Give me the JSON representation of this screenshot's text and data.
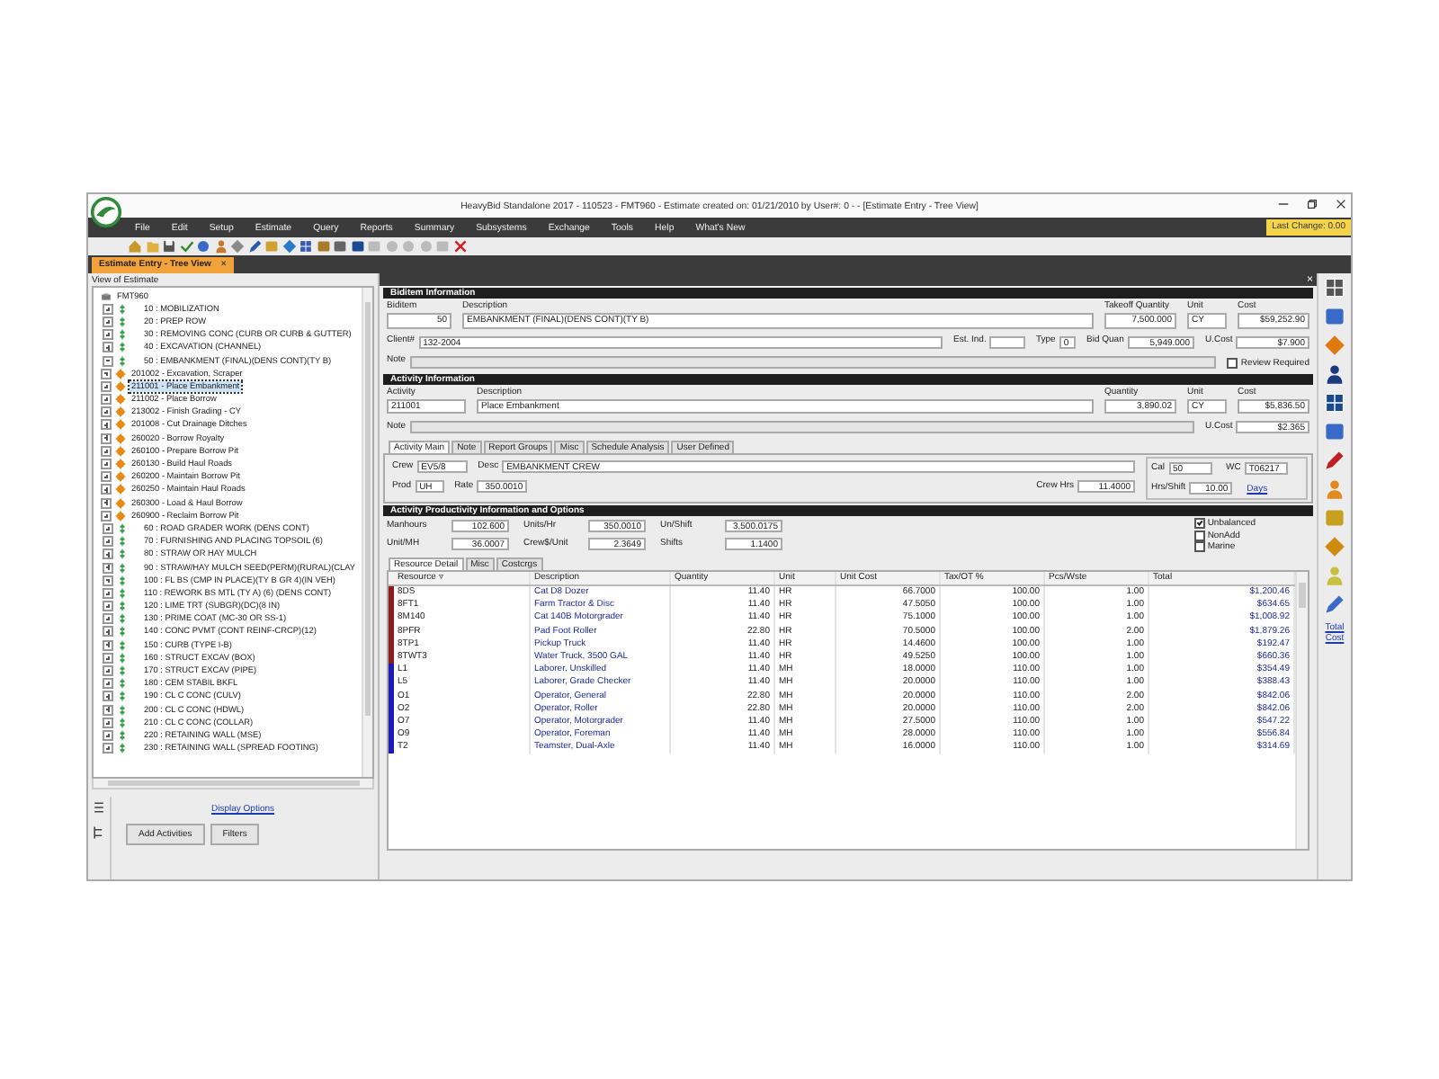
{
  "window": {
    "title": "HeavyBid Standalone 2017 - 110523 - FMT960 - Estimate created on: 01/21/2010 by User#: 0 - - [Estimate Entry - Tree View]"
  },
  "menu": [
    "File",
    "Edit",
    "Setup",
    "Estimate",
    "Query",
    "Reports",
    "Summary",
    "Subsystems",
    "Exchange",
    "Tools",
    "Help",
    "What's New"
  ],
  "last_change": "Last Change: 0.00",
  "document_tab": {
    "label": "Estimate Entry - Tree View",
    "close": "×"
  },
  "panel_close": "×",
  "tree": {
    "caption": "View of Estimate",
    "root": "FMT960",
    "items": [
      {
        "label": "10 : MOBILIZATION",
        "expanded": false
      },
      {
        "label": "20 : PREP ROW",
        "expanded": false
      },
      {
        "label": "30 : REMOVING CONC (CURB OR CURB & GUTTER)",
        "expanded": false
      },
      {
        "label": "40 : EXCAVATION (CHANNEL)",
        "expanded": false
      },
      {
        "label": "50 : EMBANKMENT (FINAL)(DENS CONT)(TY B)",
        "expanded": true,
        "children": [
          {
            "label": "201002 - Excavation, Scraper",
            "selected": false
          },
          {
            "label": "211001 - Place Embankment",
            "selected": true
          },
          {
            "label": "211002 - Place Borrow",
            "selected": false
          },
          {
            "label": "213002 - Finish Grading - CY",
            "selected": false
          },
          {
            "label": "201008 - Cut Drainage Ditches",
            "selected": false
          },
          {
            "label": "260020 - Borrow Royalty",
            "selected": false
          },
          {
            "label": "260100 - Prepare Borrow Pit",
            "selected": false
          },
          {
            "label": "260130 - Build Haul Roads",
            "selected": false
          },
          {
            "label": "260200 - Maintain Borrow Pit",
            "selected": false
          },
          {
            "label": "260250 - Maintain Haul Roads",
            "selected": false
          },
          {
            "label": "260300 - Load & Haul Borrow",
            "selected": false
          },
          {
            "label": "260900 - Reclaim Borrow Pit",
            "selected": false
          }
        ]
      },
      {
        "label": "60 : ROAD GRADER WORK (DENS CONT)",
        "expanded": false
      },
      {
        "label": "70 : FURNISHING AND PLACING TOPSOIL (6)",
        "expanded": false
      },
      {
        "label": "80 : STRAW OR HAY MULCH",
        "expanded": false
      },
      {
        "label": "90 : STRAW/HAY MULCH SEED(PERM)(RURAL)(CLAY",
        "expanded": false
      },
      {
        "label": "100 : FL BS (CMP IN PLACE)(TY B GR 4)(IN VEH)",
        "expanded": false
      },
      {
        "label": "110 : REWORK BS MTL (TY A) (6) (DENS CONT)",
        "expanded": false
      },
      {
        "label": "120 : LIME TRT (SUBGR)(DC)(8 IN)",
        "expanded": false
      },
      {
        "label": "130 : PRIME COAT (MC-30 OR SS-1)",
        "expanded": false
      },
      {
        "label": "140 : CONC PVMT (CONT REINF-CRCP)(12)",
        "expanded": false
      },
      {
        "label": "150 : CURB (TYPE I-B)",
        "expanded": false
      },
      {
        "label": "160 : STRUCT EXCAV (BOX)",
        "expanded": false
      },
      {
        "label": "170 : STRUCT EXCAV (PIPE)",
        "expanded": false
      },
      {
        "label": "180 : CEM STABIL BKFL",
        "expanded": false
      },
      {
        "label": "190 : CL C CONC (CULV)",
        "expanded": false
      },
      {
        "label": "200 : CL C CONC (HDWL)",
        "expanded": false
      },
      {
        "label": "210 : CL C CONC (COLLAR)",
        "expanded": false
      },
      {
        "label": "220 : RETAINING WALL (MSE)",
        "expanded": false
      },
      {
        "label": "230 : RETAINING WALL (SPREAD FOOTING)",
        "expanded": false
      }
    ]
  },
  "left_footer": {
    "link": "Display Options",
    "buttons": [
      "Add Activities",
      "Filters"
    ]
  },
  "biditem": {
    "title": "Biditem Information",
    "fields": [
      {
        "label": "Biditem",
        "value": "50"
      },
      {
        "label": "Description",
        "value": "EMBANKMENT (FINAL)(DENS CONT)(TY B)"
      },
      {
        "label": "Takeoff Quantity",
        "value": "7,500.000"
      },
      {
        "label": "Unit",
        "value": "CY"
      },
      {
        "label": "Cost",
        "value": "$59,252.90"
      },
      {
        "label": "Client#",
        "value": "132-2004"
      },
      {
        "label": "Est. Ind."
      },
      {
        "label": "Type",
        "value": "0"
      },
      {
        "label": "Bid Quan",
        "value": "5,949.000"
      },
      {
        "label": "U.Cost",
        "value": "$7.900"
      },
      {
        "label": "Note"
      }
    ],
    "review": {
      "label": "Review Required",
      "checked": false
    }
  },
  "activity": {
    "title": "Activity Information",
    "fields": [
      {
        "label": "Activity",
        "value": "211001"
      },
      {
        "label": "Description",
        "value": "Place Embankment"
      },
      {
        "label": "Quantity",
        "value": "3,890.02"
      },
      {
        "label": "Unit",
        "value": "CY"
      },
      {
        "label": "Cost",
        "value": "$5,836.50"
      },
      {
        "label": "Note"
      },
      {
        "label": "U.Cost",
        "value": "$2.365"
      }
    ]
  },
  "activity_tabs": [
    {
      "label": "Activity Main",
      "selected": true
    },
    {
      "label": "Note",
      "selected": false
    },
    {
      "label": "Report Groups",
      "selected": false
    },
    {
      "label": "Misc",
      "selected": false
    },
    {
      "label": "Schedule Analysis",
      "selected": false
    },
    {
      "label": "User Defined",
      "selected": false
    }
  ],
  "crew": {
    "fields": [
      {
        "label": "Crew",
        "value": "EV5/8"
      },
      {
        "label": "Desc",
        "value": "EMBANKMENT CREW"
      },
      {
        "label": "Cal",
        "value": "50"
      },
      {
        "label": "WC",
        "value": "T06217"
      },
      {
        "label": "Prod",
        "value": "UH"
      },
      {
        "label": "Rate",
        "value": "350.0010"
      },
      {
        "label": "Crew Hrs",
        "value": "11.4000"
      },
      {
        "label": "Hrs/Shift",
        "value": "10.00"
      }
    ],
    "days_link": "Days"
  },
  "productivity": {
    "title": "Activity Productivity Information and Options",
    "fields": [
      {
        "label": "Manhours",
        "value": "102.600"
      },
      {
        "label": "Units/Hr",
        "value": "350.0010"
      },
      {
        "label": "Un/Shift",
        "value": "3,500.0175"
      },
      {
        "label": "Unit/MH",
        "value": "36.0007"
      },
      {
        "label": "Crew$/Unit",
        "value": "2.3649"
      },
      {
        "label": "Shifts",
        "value": "1.1400"
      }
    ],
    "options": [
      {
        "label": "Unbalanced",
        "checked": true
      },
      {
        "label": "NonAdd",
        "checked": false
      },
      {
        "label": "Marine",
        "checked": false
      }
    ]
  },
  "resource_tabs": [
    {
      "label": "Resource Detail",
      "selected": true
    },
    {
      "label": "Misc",
      "selected": false
    },
    {
      "label": "Costcrgs",
      "selected": false
    }
  ],
  "table": {
    "columns": [
      "Resource ▿",
      "Description",
      "Quantity",
      "Unit",
      "Unit Cost",
      "Tax/OT %",
      "Pcs/Wste",
      "Total"
    ],
    "rows": [
      {
        "color": "#8b1c1c",
        "cells": [
          "8DS",
          "Cat D8 Dozer",
          "11.40",
          "HR",
          "66.7000",
          "100.00",
          "1.00",
          "$1,200.46"
        ]
      },
      {
        "color": "#8b1c1c",
        "cells": [
          "8FT1",
          "Farm Tractor & Disc",
          "11.40",
          "HR",
          "47.5050",
          "100.00",
          "1.00",
          "$634.65"
        ]
      },
      {
        "color": "#8b1c1c",
        "cells": [
          "8M140",
          "Cat 140B Motorgrader",
          "11.40",
          "HR",
          "75.1000",
          "100.00",
          "1.00",
          "$1,008.92"
        ]
      },
      {
        "color": "#8b1c1c",
        "cells": [
          "8PFR",
          "Pad Foot Roller",
          "22.80",
          "HR",
          "70.5000",
          "100.00",
          "2.00",
          "$1,879.26"
        ]
      },
      {
        "color": "#8b1c1c",
        "cells": [
          "8TP1",
          "Pickup Truck",
          "11.40",
          "HR",
          "14.4600",
          "100.00",
          "1.00",
          "$192.47"
        ]
      },
      {
        "color": "#8b1c1c",
        "cells": [
          "8TWT3",
          "Water Truck, 3500 GAL",
          "11.40",
          "HR",
          "49.5250",
          "100.00",
          "1.00",
          "$660.36"
        ]
      },
      {
        "color": "#1c1cb4",
        "cells": [
          "L1",
          "Laborer, Unskilled",
          "11.40",
          "MH",
          "18.0000",
          "110.00",
          "1.00",
          "$354.49"
        ]
      },
      {
        "color": "#1c1cb4",
        "cells": [
          "L5",
          "Laborer, Grade Checker",
          "11.40",
          "MH",
          "20.0000",
          "110.00",
          "1.00",
          "$388.43"
        ]
      },
      {
        "color": "#1c1cb4",
        "cells": [
          "O1",
          "Operator, General",
          "22.80",
          "MH",
          "20.0000",
          "110.00",
          "2.00",
          "$842.06"
        ]
      },
      {
        "color": "#1c1cb4",
        "cells": [
          "O2",
          "Operator, Roller",
          "22.80",
          "MH",
          "20.0000",
          "110.00",
          "2.00",
          "$842.06"
        ]
      },
      {
        "color": "#1c1cb4",
        "cells": [
          "O7",
          "Operator, Motorgrader",
          "11.40",
          "MH",
          "27.5000",
          "110.00",
          "1.00",
          "$547.22"
        ]
      },
      {
        "color": "#1c1cb4",
        "cells": [
          "O9",
          "Operator, Foreman",
          "11.40",
          "MH",
          "28.0000",
          "110.00",
          "1.00",
          "$556.84"
        ]
      },
      {
        "color": "#1c1cb4",
        "cells": [
          "T2",
          "Teamster, Dual-Axle",
          "11.40",
          "MH",
          "16.0000",
          "110.00",
          "1.00",
          "$314.69"
        ]
      }
    ]
  },
  "side_link": "Total Cost"
}
